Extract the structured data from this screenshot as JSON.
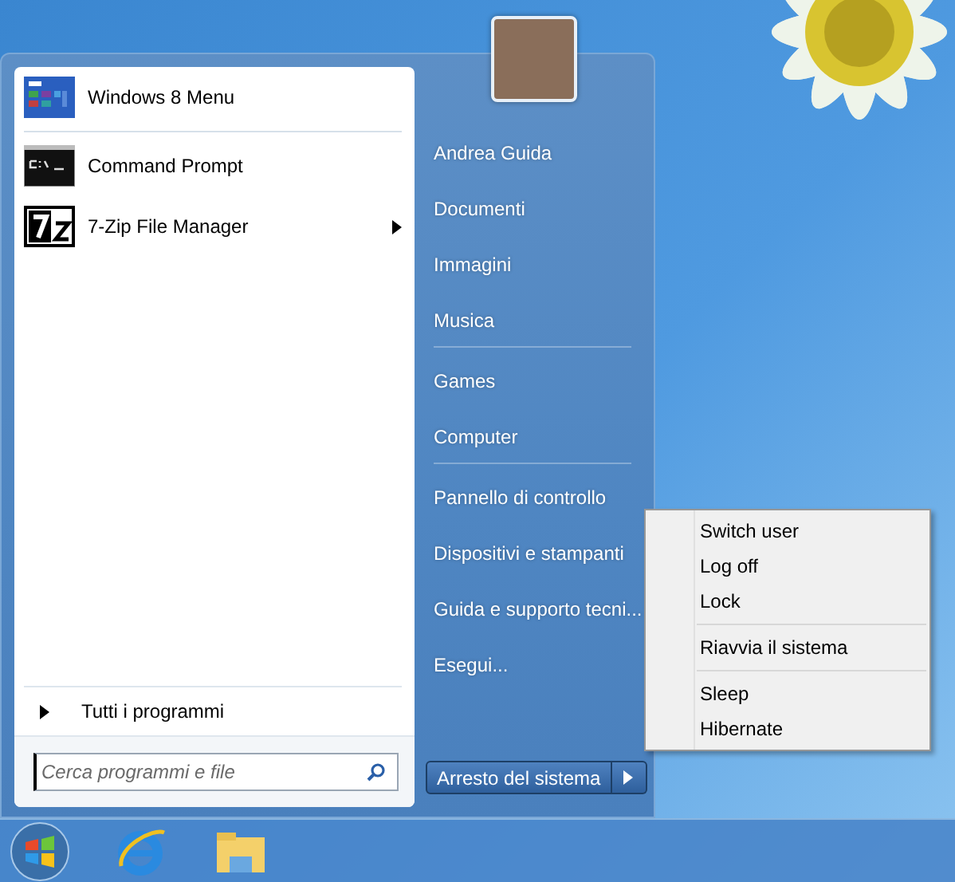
{
  "start_menu": {
    "pinned": [
      {
        "label": "Windows 8 Menu",
        "kind": "tiles",
        "submenu": false
      },
      {
        "label": "Command Prompt",
        "kind": "console",
        "submenu": false
      },
      {
        "label": "7-Zip File Manager",
        "kind": "sevenzip",
        "submenu": true
      }
    ],
    "all_programs": "Tutti i programmi",
    "search": {
      "placeholder": "Cerca programmi e file"
    },
    "places": [
      [
        "Andrea Guida",
        "Documenti",
        "Immagini",
        "Musica"
      ],
      [
        "Games",
        "Computer"
      ],
      [
        "Pannello di controllo",
        "Dispositivi e stampanti",
        "Guida e supporto tecni...",
        "Esegui..."
      ]
    ],
    "shutdown": {
      "label": "Arresto del sistema"
    }
  },
  "power_menu": [
    [
      "Switch user",
      "Log off",
      "Lock"
    ],
    [
      "Riavvia il sistema"
    ],
    [
      "Sleep",
      "Hibernate"
    ]
  ]
}
